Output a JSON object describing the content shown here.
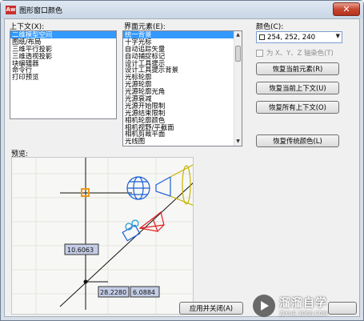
{
  "window": {
    "app_icon_text": "Aw",
    "title": "图形窗口颜色",
    "close_glyph": "✕"
  },
  "context": {
    "label": "上下文(X):",
    "items": [
      "二维模型空间",
      "图纸/布局",
      "三维平行投影",
      "三维透视投影",
      "块编辑器",
      "命令行",
      "打印预览"
    ],
    "selected_index": 0
  },
  "interface_elements": {
    "label": "界面元素(E):",
    "items": [
      "统一背景",
      "十字光标",
      "自动追踪矢量",
      "自动捕捉标记",
      "设计工具提示",
      "设计工具提示背景",
      "光标轮廓",
      "光源轮廓",
      "光源轮廓光角",
      "光源衰减",
      "光源开始限制",
      "光源结束限制",
      "相机轮廓颜色",
      "相机视野/平截面",
      "相机剪裁平面",
      "光线图"
    ],
    "selected_index": 0
  },
  "color": {
    "label": "颜色(C):",
    "value": "254, 252, 240",
    "swatch_color": "#fefcf0",
    "tint_checkbox_label": "为 X、Y、Z 轴染色(T)",
    "tint_checked": false
  },
  "buttons": {
    "restore_current_element": "恢复当前元素(R)",
    "restore_current_context": "恢复当前上下文(U)",
    "restore_all_contexts": "恢复所有上下文(O)",
    "restore_classic_colors": "恢复传统颜色(L)",
    "apply_and_close": "应用并关闭(A)"
  },
  "preview": {
    "label": "预览:",
    "dim_vertical": "10.6063",
    "dim_horizontal_1": "28.2280",
    "dim_horizontal_2": "6.0884"
  },
  "watermark": {
    "text": "溜溜自学",
    "url": "ZIXUE.3D66.COM"
  }
}
